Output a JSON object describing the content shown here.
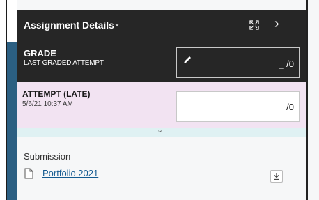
{
  "header": {
    "title": "Assignment Details",
    "title_chevron": "⌄",
    "expand_icon": "expand-icon",
    "next_icon": "›"
  },
  "grade": {
    "label": "GRADE",
    "sublabel": "LAST GRADED ATTEMPT",
    "value": "_ /0",
    "edit_icon": "pencil-icon"
  },
  "attempt": {
    "label": "ATTEMPT (LATE)",
    "date": "5/6/21 10:37 AM",
    "value": "/0"
  },
  "collapse": {
    "chevron": "⌄"
  },
  "submission": {
    "label": "Submission",
    "file_name": "Portfolio 2021",
    "file_icon": "document-icon",
    "download_icon": "download-icon"
  },
  "colors": {
    "header_bg": "#262626",
    "attempt_bg": "#f2e3f2",
    "collapse_bg": "#dff1f3",
    "link": "#145b91",
    "accent_strip": "#2b5f82"
  }
}
